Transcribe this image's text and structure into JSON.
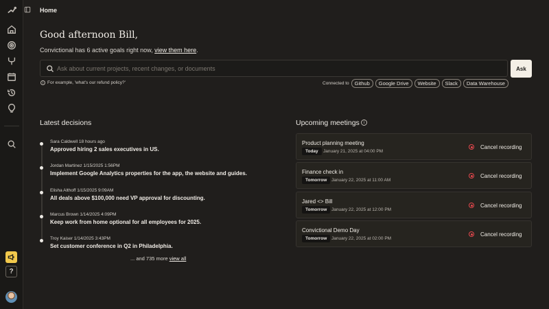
{
  "header": {
    "page_title": "Home"
  },
  "sidebar": {
    "items": [
      {
        "icon": "logo-icon"
      },
      {
        "icon": "home-icon"
      },
      {
        "icon": "target-icon"
      },
      {
        "icon": "branch-icon"
      },
      {
        "icon": "calendar-icon"
      },
      {
        "icon": "history-icon"
      },
      {
        "icon": "lightbulb-icon"
      },
      {
        "icon": "search-icon"
      }
    ],
    "help_label": "?"
  },
  "greeting": {
    "title": "Good afternoon Bill,",
    "goals_prefix": "Convictional has 6 active goals right now,",
    "goals_link": "view them here",
    "goals_suffix": "."
  },
  "search": {
    "placeholder": "Ask about current projects, recent changes, or documents",
    "value": "",
    "ask_label": "Ask",
    "example": "For example, 'what's our refund policy?'",
    "connected_label": "Connected to",
    "sources": [
      "Github",
      "Google Drive",
      "Website",
      "Slack",
      "Data Warehouse"
    ]
  },
  "decisions": {
    "title": "Latest decisions",
    "items": [
      {
        "meta": "Sara Caldwell 18 hours ago",
        "text": "Approved hiring 2 sales executives in US."
      },
      {
        "meta": "Jordan Martinez 1/15/2025 1:56PM",
        "text": "Implement Google Analytics properties for the app, the website and guides."
      },
      {
        "meta": "Elisha Althoff 1/15/2025 9:09AM",
        "text": "All deals above $100,000 need VP approval for discounting."
      },
      {
        "meta": "Marcus Brown 1/14/2025 4:09PM",
        "text": "Keep work from home optional for all employees for 2025."
      },
      {
        "meta": "Troy Kaiser 1/14/2025 3:43PM",
        "text": "Set customer conference in Q2 in Philadelphia."
      }
    ],
    "more_prefix": "... and 735 more",
    "more_link": "view all"
  },
  "meetings": {
    "title": "Upcoming meetings",
    "cancel_label": "Cancel recording",
    "items": [
      {
        "title": "Product planning meeting",
        "badge": "Today",
        "date": "January 21, 2025 at 04:00 PM"
      },
      {
        "title": "Finance check in",
        "badge": "Tomorrow",
        "date": "January 22, 2025 at 11:00 AM"
      },
      {
        "title": "Jared <> Bill",
        "badge": "Tomorrow",
        "date": "January 22, 2025 at 12:00 PM"
      },
      {
        "title": "Convictional Demo Day",
        "badge": "Tomorrow",
        "date": "January 22, 2025 at 02:00 PM"
      }
    ]
  },
  "colors": {
    "background": "#201e1c",
    "record_red": "#e5484d",
    "announce_yellow": "#f2c94c",
    "ask_button": "#f4efe6"
  }
}
